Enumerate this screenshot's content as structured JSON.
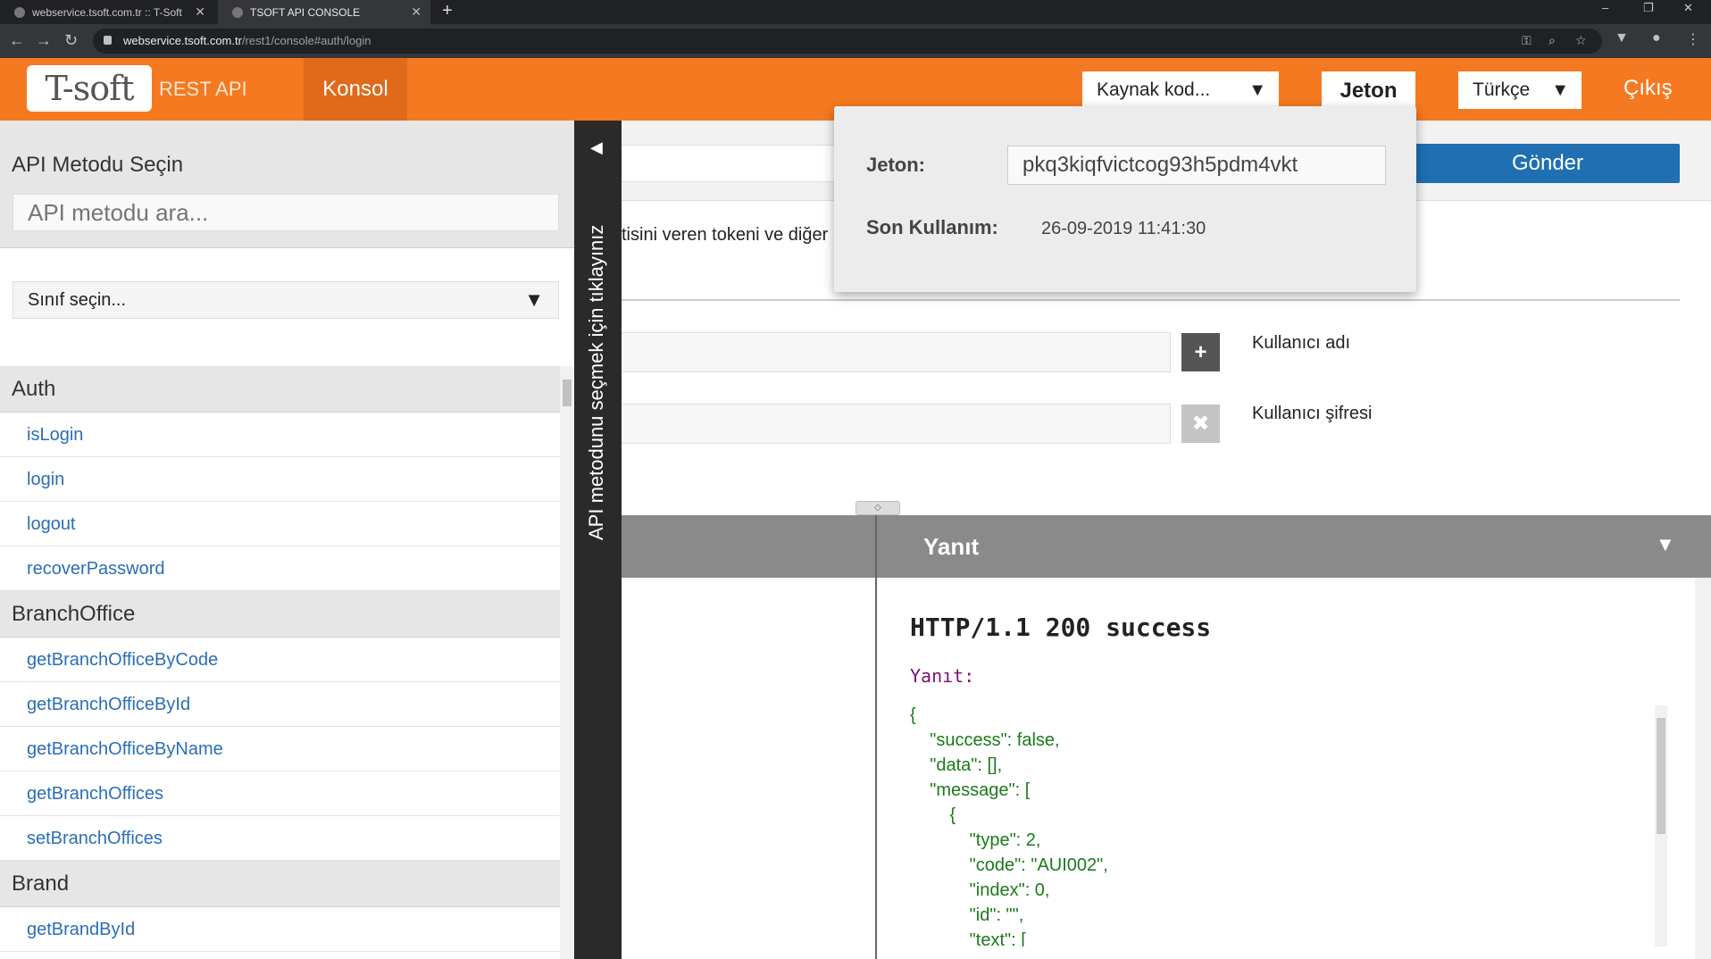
{
  "browser": {
    "tabs": [
      {
        "title": "webservice.tsoft.com.tr :: T-Soft V"
      },
      {
        "title": "TSOFT API CONSOLE"
      }
    ],
    "new_tab": "+",
    "url_host": "webservice.tsoft.com.tr",
    "url_path": "/rest1/console#auth/login",
    "window_controls": [
      "–",
      "❐",
      "✕"
    ]
  },
  "header": {
    "logo_text": "T-soft",
    "brand_sub": "REST API",
    "nav_konsol": "Konsol",
    "source_select": "Kaynak kod...",
    "jeton": "Jeton",
    "language_select": "Türkçe",
    "logout": "Çıkış"
  },
  "sidebar": {
    "title": "API Metodu Seçin",
    "search_placeholder": "API metodu ara...",
    "class_select": "Sınıf seçin...",
    "groups": [
      {
        "name": "Auth",
        "items": [
          "isLogin",
          "login",
          "logout",
          "recoverPassword"
        ]
      },
      {
        "name": "BranchOffice",
        "items": [
          "getBranchOfficeByCode",
          "getBranchOfficeById",
          "getBranchOfficeByName",
          "getBranchOffices",
          "setBranchOffices"
        ]
      },
      {
        "name": "Brand",
        "items": [
          "getBrandById"
        ]
      }
    ],
    "toggle_text": "API metodunu seçmek için tıklayınız"
  },
  "main": {
    "send_button": "Gönder",
    "description": "tisini veren tokeni ve diğer",
    "params": [
      {
        "label": "Kullanıcı adı",
        "button": "+"
      },
      {
        "label": "Kullanıcı şifresi",
        "button": "✖"
      }
    ]
  },
  "response": {
    "title": "Yanıt",
    "status": "HTTP/1.1 200 success",
    "label": "Yanıt:",
    "json_lines": [
      "{",
      "    \"success\": false,",
      "    \"data\": [],",
      "    \"message\": [",
      "        {",
      "            \"type\": 2,",
      "            \"code\": \"AUI002\",",
      "            \"index\": 0,",
      "            \"id\": \"\",",
      "            \"text\": ["
    ]
  },
  "token_popup": {
    "token_label": "Jeton:",
    "token_value": "pkq3kiqfvictcog93h5pdm4vkt",
    "last_used_label": "Son Kullanım:",
    "last_used_value": "26-09-2019 11:41:30"
  },
  "colors": {
    "brand_orange": "#f47920",
    "send_blue": "#1f6fb2",
    "link_blue": "#2a6eb5",
    "json_green": "#1a7a1a"
  }
}
